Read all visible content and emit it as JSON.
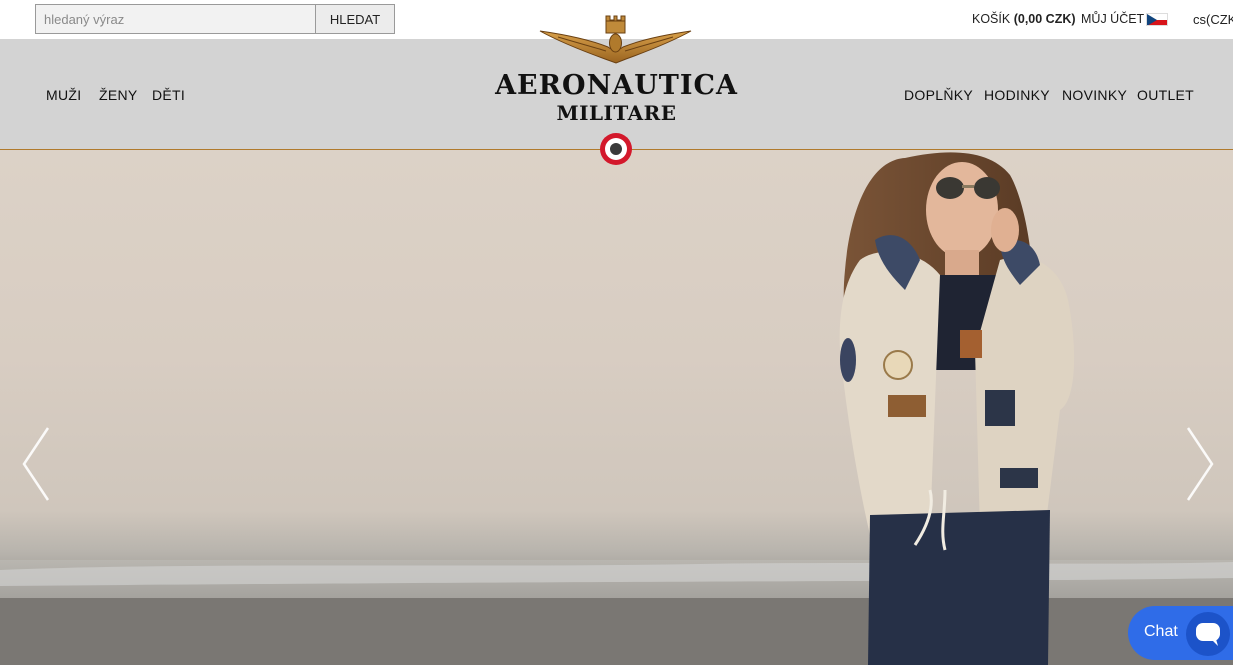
{
  "search": {
    "placeholder": "hledaný výraz",
    "button_label": "HLEDAT"
  },
  "header": {
    "cart_label": "KOŠÍK",
    "cart_total": "(0,00 CZK)",
    "account_label": "MŮJ ÚČET",
    "flag_icon": "czech-flag-icon",
    "language": "cs(CZK"
  },
  "logo": {
    "line1": "AERONAUTICA",
    "line2": "MILITARE",
    "icon": "eagle-crown-icon"
  },
  "nav": {
    "left": [
      {
        "label": "MUŽI"
      },
      {
        "label": "ŽENY"
      },
      {
        "label": "DĚTI"
      }
    ],
    "right": [
      {
        "label": "DOPLŇKY"
      },
      {
        "label": "HODINKY"
      },
      {
        "label": "NOVINKY"
      },
      {
        "label": "OUTLET"
      }
    ]
  },
  "slider": {
    "prev_icon": "chevron-left-icon",
    "next_icon": "chevron-right-icon"
  },
  "chat": {
    "label": "Chat",
    "icon": "chat-bubble-icon"
  },
  "colors": {
    "nav_background": "#d3d3d3",
    "accent_line": "#b07a2c",
    "roundel_red": "#d3182b",
    "chat_blue": "#2f6ce8"
  }
}
